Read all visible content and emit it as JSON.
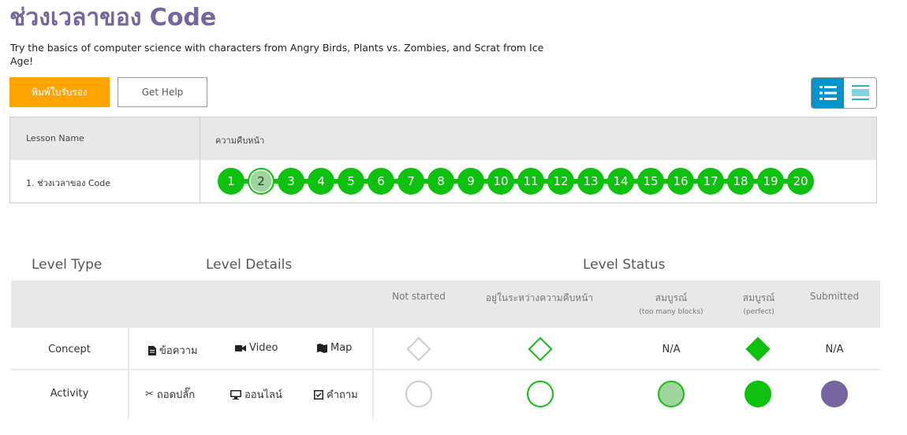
{
  "page": {
    "title": "ช่วงเวลาของ Code",
    "description": "Try the basics of computer science with characters from Angry Birds, Plants vs. Zombies, and Scrat from Ice Age!"
  },
  "buttons": {
    "certificate": "พิมพ์ใบรับรอง",
    "help": "Get Help"
  },
  "progress_table": {
    "header_lesson": "Lesson Name",
    "header_progress": "ความคืบหน้า",
    "lesson_name": "1. ช่วงเวลาของ Code",
    "levels": [
      {
        "label": "1",
        "status": "perfect"
      },
      {
        "label": "2",
        "status": "attempted"
      },
      {
        "label": "3",
        "status": "perfect"
      },
      {
        "label": "4",
        "status": "perfect"
      },
      {
        "label": "5",
        "status": "perfect"
      },
      {
        "label": "6",
        "status": "perfect"
      },
      {
        "label": "7",
        "status": "perfect"
      },
      {
        "label": "8",
        "status": "perfect"
      },
      {
        "label": "9",
        "status": "perfect"
      },
      {
        "label": "10",
        "status": "perfect"
      },
      {
        "label": "11",
        "status": "perfect"
      },
      {
        "label": "12",
        "status": "perfect"
      },
      {
        "label": "13",
        "status": "perfect"
      },
      {
        "label": "14",
        "status": "perfect"
      },
      {
        "label": "15",
        "status": "perfect"
      },
      {
        "label": "16",
        "status": "perfect"
      },
      {
        "label": "17",
        "status": "perfect"
      },
      {
        "label": "18",
        "status": "perfect"
      },
      {
        "label": "19",
        "status": "perfect"
      },
      {
        "label": "20",
        "status": "perfect"
      }
    ]
  },
  "legend": {
    "level_type": "Level Type",
    "level_details": "Level Details",
    "level_status": "Level Status",
    "statuses": {
      "not_started": "Not started",
      "in_progress": "อยู่ในระหว่างความคืบหน้า",
      "complete_too_many": "สมบูรณ์",
      "complete_too_many_sub": "(too many blocks)",
      "complete_perfect": "สมบูรณ์",
      "complete_perfect_sub": "(perfect)",
      "submitted": "Submitted"
    },
    "concept": {
      "label": "Concept",
      "details": [
        "ข้อความ",
        "Video",
        "Map"
      ],
      "na": "N/A"
    },
    "activity": {
      "label": "Activity",
      "details": [
        "ถอดปลั๊ก",
        "ออนไลน์",
        "คำถาม"
      ]
    }
  },
  "colors": {
    "title": "#7665a0",
    "accent_orange": "#ffa400",
    "perfect_green": "#0ec10e",
    "too_many_green": "#9fd49f",
    "submitted_purple": "#7665a0",
    "toggle_blue": "#0094ca",
    "header_gray": "#e7e8ea"
  }
}
